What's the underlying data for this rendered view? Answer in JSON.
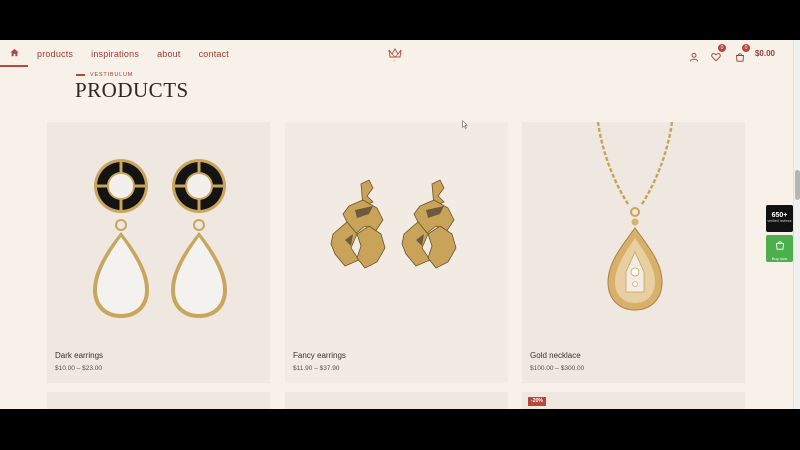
{
  "nav": {
    "home_icon": "home-icon",
    "items": [
      "products",
      "inspirations",
      "about",
      "contact"
    ]
  },
  "header_right": {
    "account_icon": "user-icon",
    "wishlist_icon": "heart-icon",
    "wishlist_count": "0",
    "cart_icon": "shopping-bag-icon",
    "cart_count": "0",
    "cart_total": "$0.00"
  },
  "section": {
    "eyebrow": "VESTIBULUM",
    "title": "PRODUCTS"
  },
  "products": [
    {
      "name": "Dark earrings",
      "price": "$10.00 – $23.00"
    },
    {
      "name": "Fancy earrings",
      "price": "$11.90 – $37.90"
    },
    {
      "name": "Gold necklace",
      "price": "$100.00 – $300.00"
    }
  ],
  "sale_badge": "-20%",
  "widgets": {
    "reviews_count": "650+",
    "reviews_label": "verified reviews",
    "buy_label": "Buy now"
  },
  "colors": {
    "accent": "#b7473a",
    "background": "#f7f1ea",
    "buy_green": "#4cae4c"
  }
}
